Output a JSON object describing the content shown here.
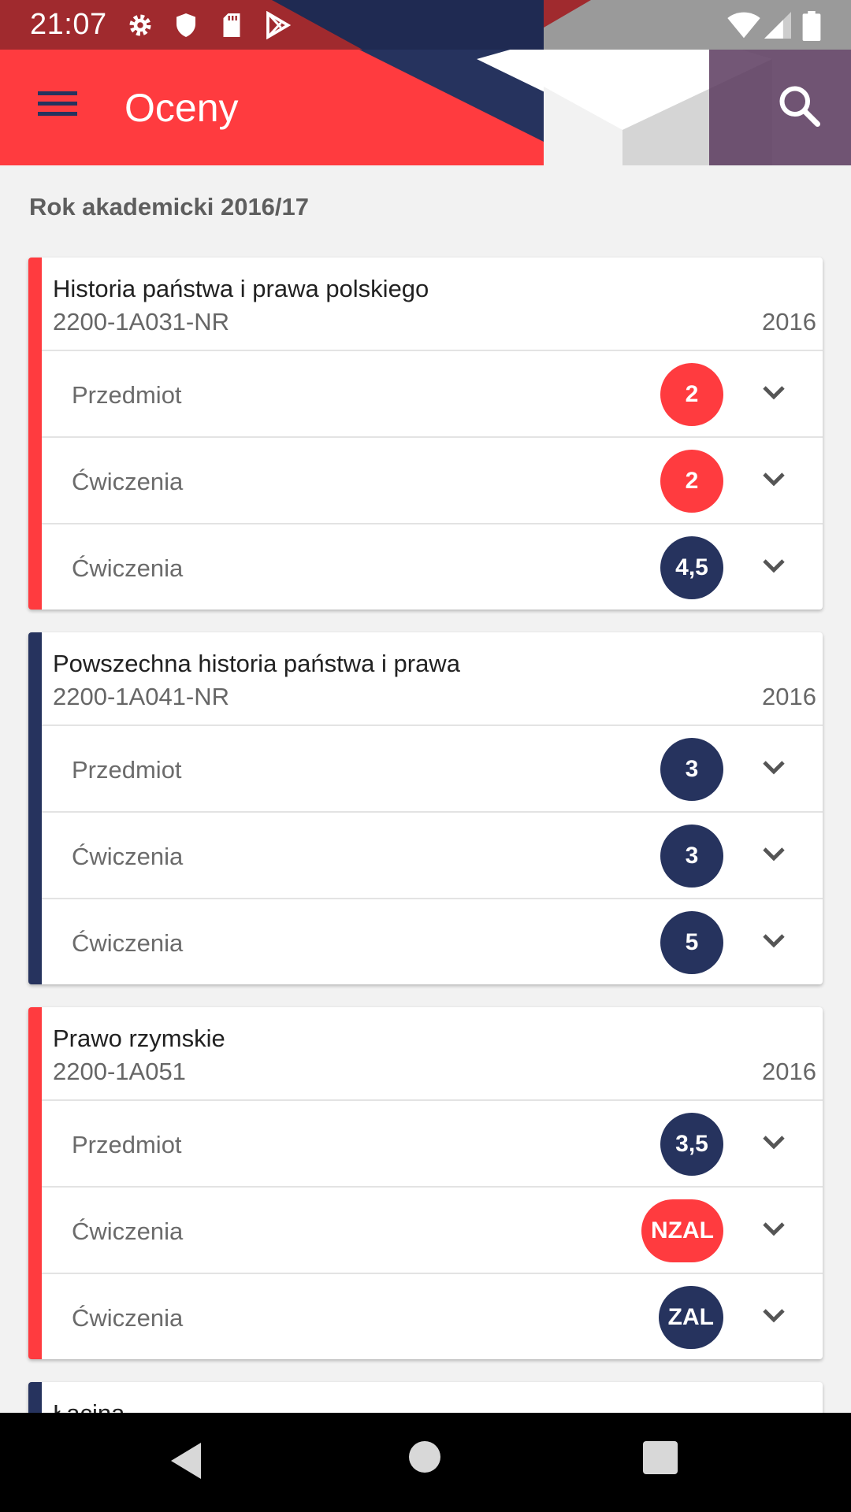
{
  "status_bar": {
    "time": "21:07",
    "icons": [
      "settings-icon",
      "shield-icon",
      "sd-card-icon",
      "play-store-icon",
      "wifi-icon",
      "signal-icon",
      "battery-icon"
    ]
  },
  "app_bar": {
    "title": "Oceny",
    "menu_icon": "menu-icon",
    "search_icon": "search-icon"
  },
  "colors": {
    "accent_red": "#ff3b3f",
    "navy": "#26335e"
  },
  "academic_year": "Rok akademicki 2016/17",
  "courses": [
    {
      "name": "Historia państwa i prawa polskiego",
      "code": "2200-1A031-NR",
      "year": "2016",
      "accent": "red",
      "rows": [
        {
          "label": "Przedmiot",
          "grade": "2",
          "color": "red"
        },
        {
          "label": "Ćwiczenia",
          "grade": "2",
          "color": "red"
        },
        {
          "label": "Ćwiczenia",
          "grade": "4,5",
          "color": "navy"
        }
      ]
    },
    {
      "name": "Powszechna historia państwa i prawa",
      "code": "2200-1A041-NR",
      "year": "2016",
      "accent": "navy",
      "rows": [
        {
          "label": "Przedmiot",
          "grade": "3",
          "color": "navy"
        },
        {
          "label": "Ćwiczenia",
          "grade": "3",
          "color": "navy"
        },
        {
          "label": "Ćwiczenia",
          "grade": "5",
          "color": "navy"
        }
      ]
    },
    {
      "name": "Prawo rzymskie",
      "code": "2200-1A051",
      "year": "2016",
      "accent": "red",
      "rows": [
        {
          "label": "Przedmiot",
          "grade": "3,5",
          "color": "navy"
        },
        {
          "label": "Ćwiczenia",
          "grade": "NZAL",
          "color": "red"
        },
        {
          "label": "Ćwiczenia",
          "grade": "ZAL",
          "color": "navy"
        }
      ]
    },
    {
      "name": "Łacina",
      "accent": "navy"
    }
  ],
  "nav_bar": [
    "back-icon",
    "home-icon",
    "recents-icon"
  ]
}
